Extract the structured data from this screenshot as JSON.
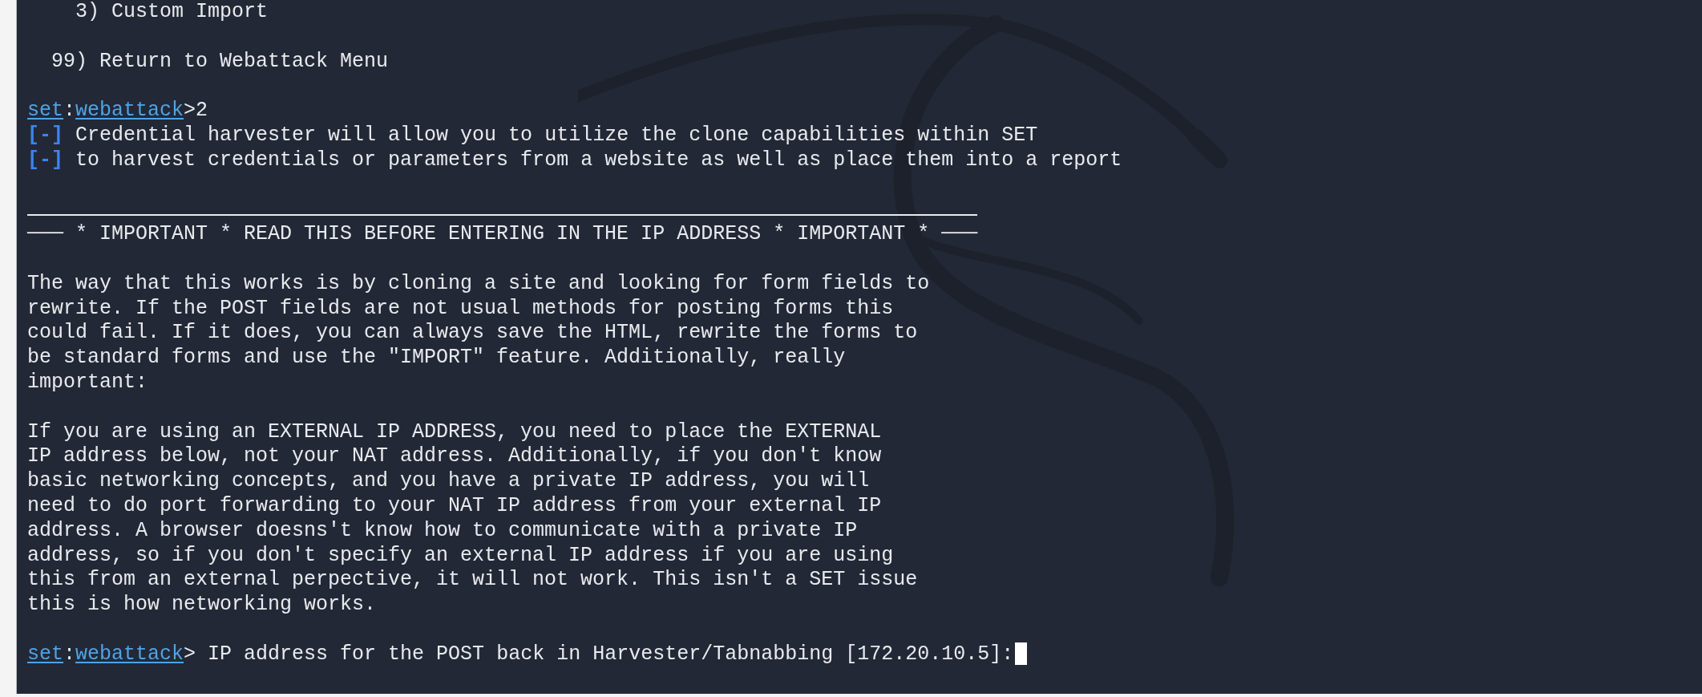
{
  "terminal": {
    "lines": [
      {
        "kind": "text",
        "text": "    3) Custom Import"
      },
      {
        "kind": "blank"
      },
      {
        "kind": "text",
        "text": "  99) Return to Webattack Menu"
      },
      {
        "kind": "blank"
      },
      {
        "kind": "prompt",
        "host": "set",
        "separator": ":",
        "module": "webattack",
        "input": ">2",
        "cursor": false
      },
      {
        "kind": "info",
        "marker": "[-]",
        "text": "Credential harvester will allow you to utilize the clone capabilities within SET"
      },
      {
        "kind": "info",
        "marker": "[-]",
        "text": "to harvest credentials or parameters from a website as well as place them into a report"
      },
      {
        "kind": "blank"
      },
      {
        "kind": "rule"
      },
      {
        "kind": "text",
        "text": "─── * IMPORTANT * READ THIS BEFORE ENTERING IN THE IP ADDRESS * IMPORTANT * ───"
      },
      {
        "kind": "blank"
      },
      {
        "kind": "text",
        "text": "The way that this works is by cloning a site and looking for form fields to"
      },
      {
        "kind": "text",
        "text": "rewrite. If the POST fields are not usual methods for posting forms this"
      },
      {
        "kind": "text",
        "text": "could fail. If it does, you can always save the HTML, rewrite the forms to"
      },
      {
        "kind": "text",
        "text": "be standard forms and use the \"IMPORT\" feature. Additionally, really"
      },
      {
        "kind": "text",
        "text": "important:"
      },
      {
        "kind": "blank"
      },
      {
        "kind": "text",
        "text": "If you are using an EXTERNAL IP ADDRESS, you need to place the EXTERNAL"
      },
      {
        "kind": "text",
        "text": "IP address below, not your NAT address. Additionally, if you don't know"
      },
      {
        "kind": "text",
        "text": "basic networking concepts, and you have a private IP address, you will"
      },
      {
        "kind": "text",
        "text": "need to do port forwarding to your NAT IP address from your external IP"
      },
      {
        "kind": "text",
        "text": "address. A browser doesns't know how to communicate with a private IP"
      },
      {
        "kind": "text",
        "text": "address, so if you don't specify an external IP address if you are using"
      },
      {
        "kind": "text",
        "text": "this from an external perpective, it will not work. This isn't a SET issue"
      },
      {
        "kind": "text",
        "text": "this is how networking works."
      },
      {
        "kind": "blank"
      },
      {
        "kind": "prompt",
        "host": "set",
        "separator": ":",
        "module": "webattack",
        "input": "> IP address for the POST back in Harvester/Tabnabbing [172.20.10.5]:",
        "cursor": true
      }
    ]
  }
}
